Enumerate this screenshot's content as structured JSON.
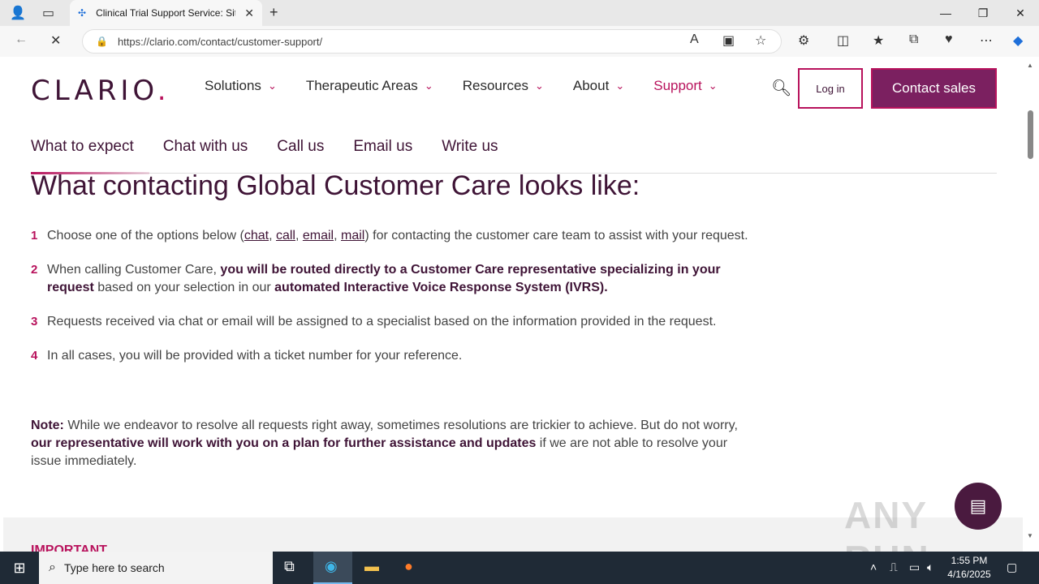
{
  "browser": {
    "tab_title": "Clinical Trial Support Service: Site",
    "url": "https://clario.com/contact/customer-support/"
  },
  "site": {
    "logo": "CLARIO",
    "logo_dot": ".",
    "nav": [
      "Solutions",
      "Therapeutic Areas",
      "Resources",
      "About",
      "Support"
    ],
    "login_label": "Log in",
    "contact_label": "Contact sales",
    "subnav": [
      "What to expect",
      "Chat with us",
      "Call us",
      "Email us",
      "Write us"
    ]
  },
  "content": {
    "heading": "What contacting Global Customer Care looks like:",
    "steps": [
      {
        "num": "1"
      },
      {
        "num": "2"
      },
      {
        "num": "3",
        "text": "Requests received via chat or email will be assigned to a specialist based on the information provided in the request."
      },
      {
        "num": "4",
        "text": "In all cases, you will be provided with a ticket number for your reference."
      }
    ],
    "step1_pre": "Choose one of the options below (",
    "step1_links": [
      "chat",
      "call",
      "email",
      "mail"
    ],
    "step1_post": ") for contacting the customer care team to assist with your request.",
    "step2_pre": "When calling Customer Care, ",
    "step2_bold1": "you will be routed directly to a Customer Care representative specializing in your request",
    "step2_mid": " based on your selection in our ",
    "step2_bold2": "automated Interactive Voice Response System (IVRS).",
    "note_label": "Note:",
    "note_pre": " While we endeavor to resolve all requests right away, sometimes resolutions are trickier to achieve. But do not worry, ",
    "note_bold": "our representative will work with you on a plan for further assistance and updates",
    "note_post": " if we are not able to resolve your issue immediately.",
    "important": "IMPORTANT"
  },
  "taskbar": {
    "search_placeholder": "Type here to search",
    "time": "1:55 PM",
    "date": "4/16/2025"
  },
  "watermark": "ANY RUN"
}
